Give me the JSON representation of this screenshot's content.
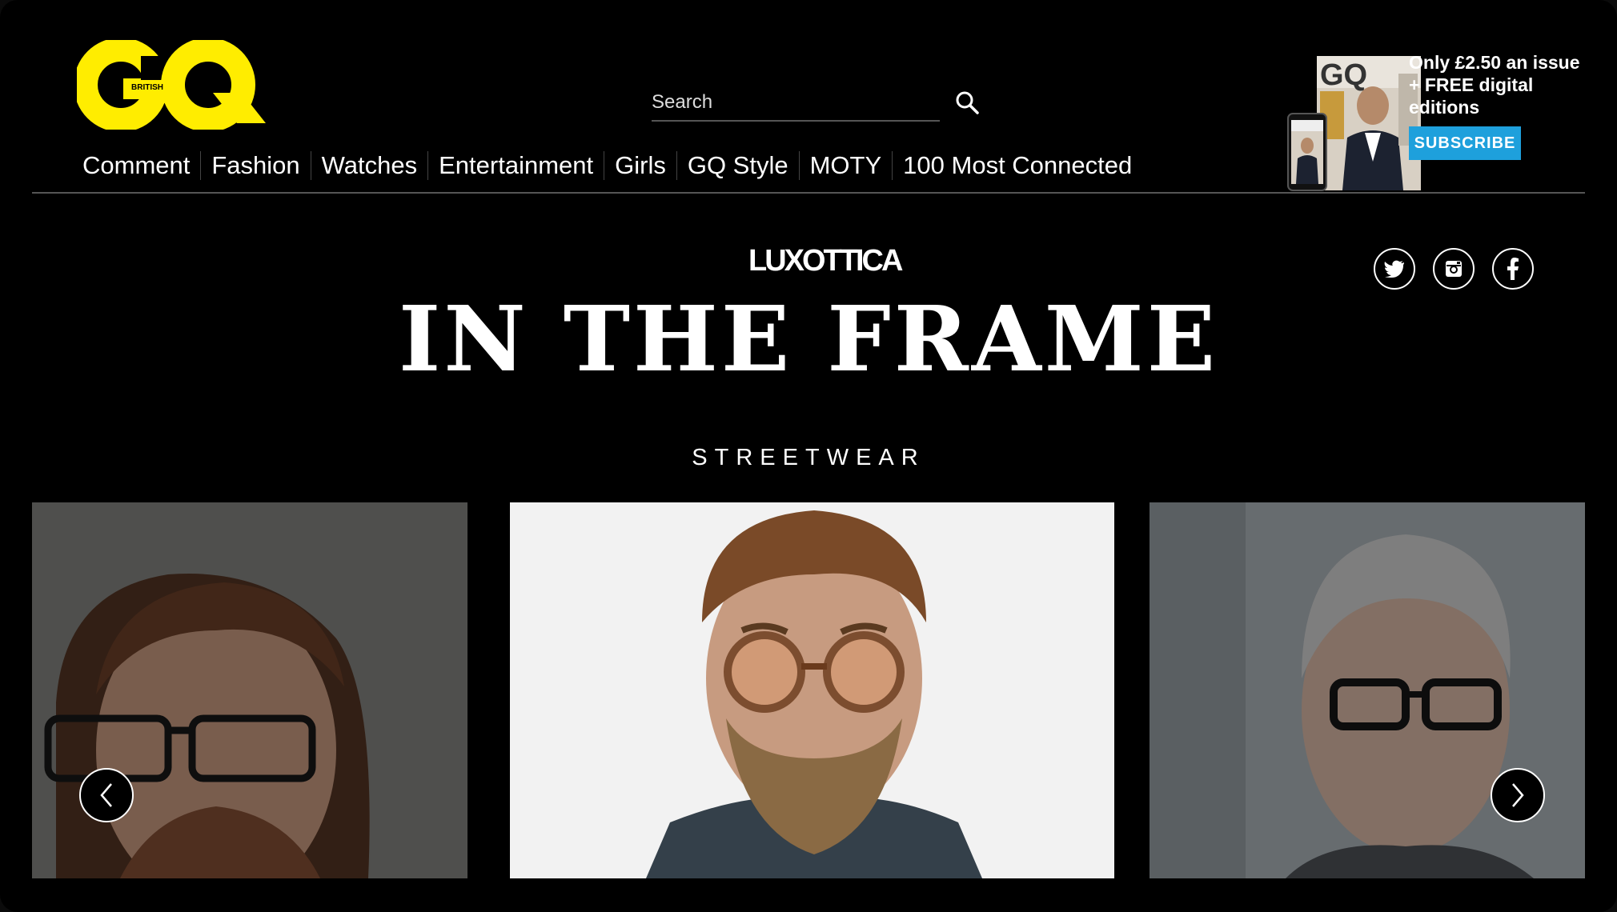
{
  "brand": {
    "logo_text": "GQ",
    "logo_subtext": "BRITISH",
    "accent_color": "#ffed00"
  },
  "search": {
    "placeholder": "Search"
  },
  "nav": {
    "items": [
      {
        "label": "Comment"
      },
      {
        "label": "Fashion"
      },
      {
        "label": "Watches"
      },
      {
        "label": "Entertainment"
      },
      {
        "label": "Girls"
      },
      {
        "label": "GQ Style"
      },
      {
        "label": "MOTY"
      },
      {
        "label": "100 Most Connected"
      }
    ]
  },
  "promo": {
    "line1": "Only £2.50 an issue",
    "line2": "+ FREE digital",
    "line3": "editions",
    "subscribe_label": "SUBSCRIBE",
    "subscribe_color": "#1ea0dc"
  },
  "hero": {
    "sponsor": "LUXOTTICA",
    "title": "IN THE FRAME",
    "section": "STREETWEAR"
  },
  "social": [
    {
      "icon": "twitter-icon"
    },
    {
      "icon": "instagram-icon"
    },
    {
      "icon": "facebook-icon"
    }
  ],
  "carousel": {
    "prev_icon": "chevron-left-icon",
    "next_icon": "chevron-right-icon"
  }
}
